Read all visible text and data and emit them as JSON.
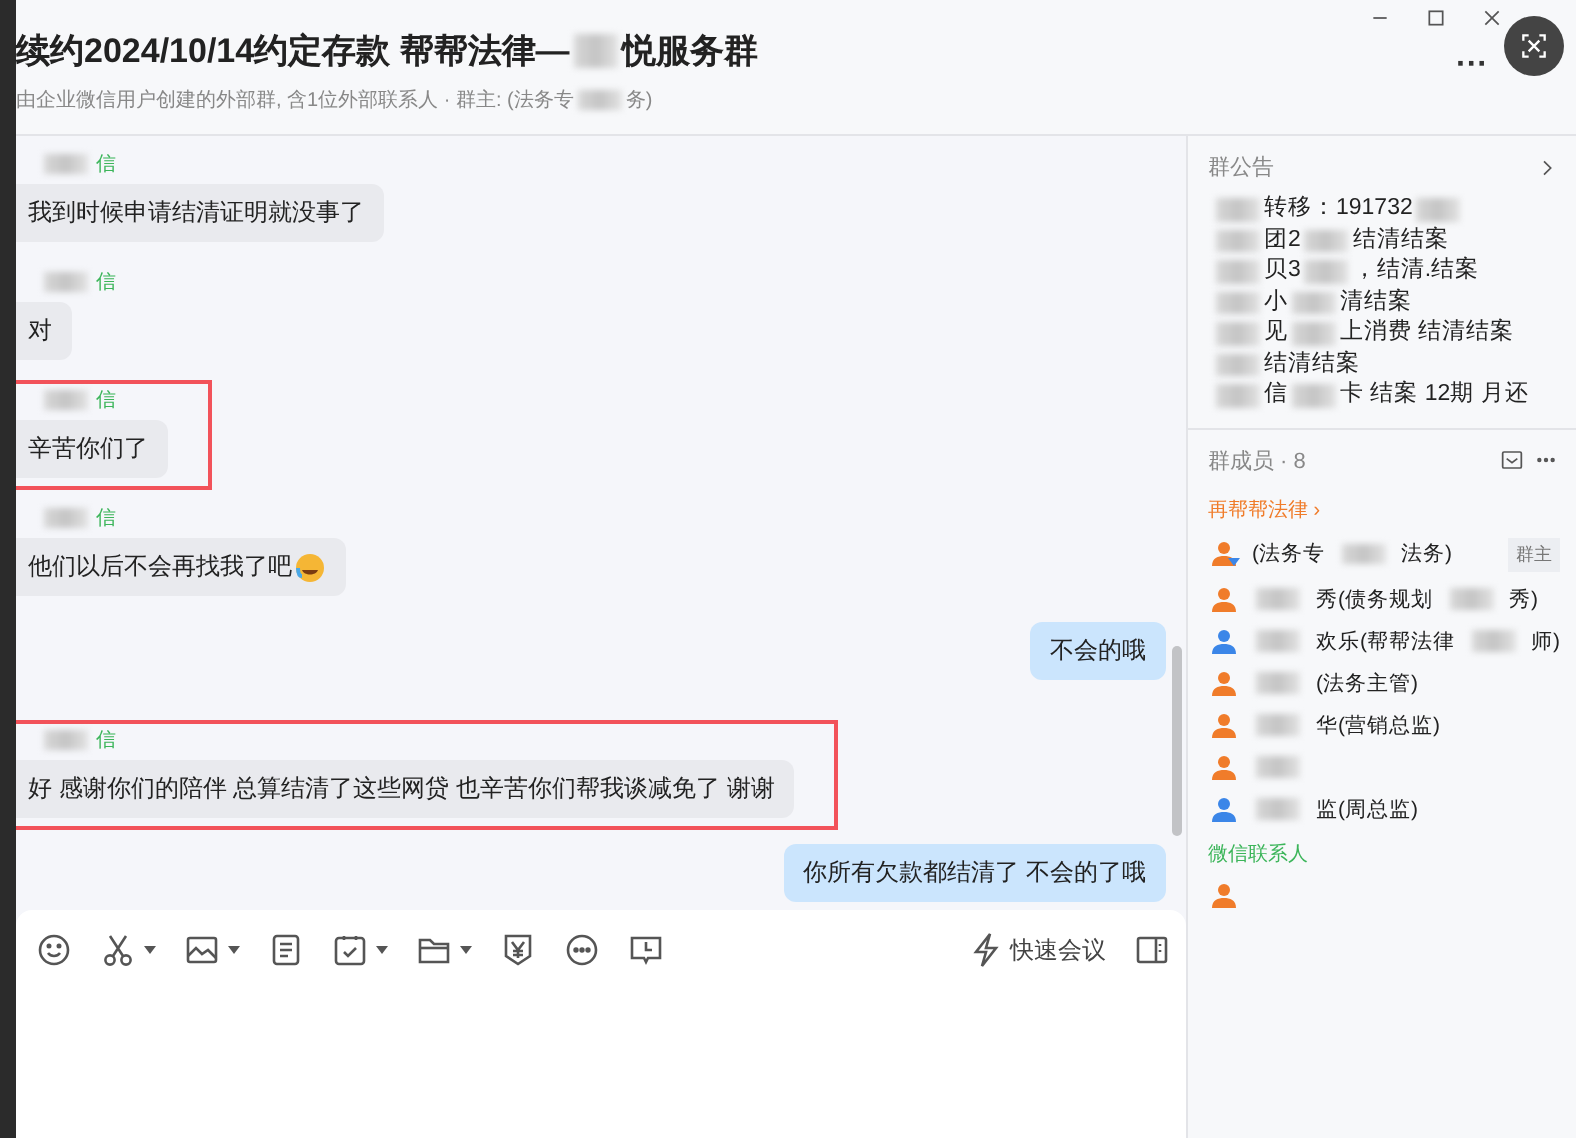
{
  "header": {
    "title": [
      {
        "kind": "text",
        "text": "续约2024/10/14约定存款 帮帮法律—"
      },
      {
        "kind": "blur"
      },
      {
        "kind": "text",
        "text": "悦服务群"
      }
    ],
    "subtitle": [
      {
        "kind": "text",
        "text": "由企业微信用户创建的外部群, 含1位外部联系人 · 群主: (法务专"
      },
      {
        "kind": "blur"
      },
      {
        "kind": "text",
        "text": "务)"
      }
    ],
    "menu": "···"
  },
  "messages": [
    {
      "kind": "received",
      "sender": "信",
      "text": "我到时候申请结清证明就没事了",
      "highlighted": false,
      "emoji": false
    },
    {
      "kind": "received",
      "sender": "信",
      "text": "对",
      "highlighted": false,
      "emoji": false
    },
    {
      "kind": "received",
      "sender": "信",
      "text": "辛苦你们了",
      "highlighted": true,
      "emoji": false
    },
    {
      "kind": "received",
      "sender": "信",
      "text": "他们以后不会再找我了吧",
      "highlighted": false,
      "emoji": true
    },
    {
      "kind": "sent",
      "text": "不会的哦",
      "highlighted": false,
      "emoji": false
    },
    {
      "kind": "received",
      "sender": "信",
      "text": "好  感谢你们的陪伴 总算结清了这些网贷 也辛苦你们帮我谈减免了   谢谢",
      "highlighted": true,
      "emoji": false
    },
    {
      "kind": "sent",
      "text": "你所有欠款都结清了 不会的了哦",
      "highlighted": false,
      "emoji": false
    }
  ],
  "composer": {
    "meeting_button": "快速会议"
  },
  "announcement": {
    "title": "群公告",
    "lines": [
      [
        {
          "kind": "blur"
        },
        {
          "kind": "text",
          "text": "转移：191732"
        },
        {
          "kind": "blur"
        }
      ],
      [
        {
          "kind": "blur"
        },
        {
          "kind": "text",
          "text": "团2"
        },
        {
          "kind": "blur"
        },
        {
          "kind": "text",
          "text": "结清结案"
        }
      ],
      [
        {
          "kind": "blur"
        },
        {
          "kind": "text",
          "text": "贝3"
        },
        {
          "kind": "blur"
        },
        {
          "kind": "text",
          "text": "，结清.结案"
        }
      ],
      [
        {
          "kind": "blur"
        },
        {
          "kind": "text",
          "text": "小"
        },
        {
          "kind": "blur"
        },
        {
          "kind": "text",
          "text": "清结案"
        }
      ],
      [
        {
          "kind": "blur"
        },
        {
          "kind": "text",
          "text": "见"
        },
        {
          "kind": "blur"
        },
        {
          "kind": "text",
          "text": "上消费 结清结案"
        }
      ],
      [
        {
          "kind": "blur"
        },
        {
          "kind": "text",
          "text": "结清结案"
        }
      ],
      [
        {
          "kind": "blur"
        },
        {
          "kind": "text",
          "text": "信"
        },
        {
          "kind": "blur"
        },
        {
          "kind": "text",
          "text": "卡 结案 12期 月还"
        }
      ]
    ]
  },
  "members": {
    "title": "群成员 · 8",
    "groups": [
      {
        "name": "再帮帮法律 ›",
        "color": "#f07c2a",
        "items": [
          {
            "color": "#f07c2a",
            "owner": true,
            "badge": "群主",
            "parts": [
              {
                "kind": "text",
                "text": "(法务专"
              },
              {
                "kind": "blur"
              },
              {
                "kind": "text",
                "text": "法务)"
              }
            ]
          },
          {
            "color": "#f07c2a",
            "owner": false,
            "parts": [
              {
                "kind": "blur"
              },
              {
                "kind": "text",
                "text": "秀(债务规划"
              },
              {
                "kind": "blur"
              },
              {
                "kind": "text",
                "text": "秀)"
              }
            ]
          },
          {
            "color": "#3b86e8",
            "owner": false,
            "parts": [
              {
                "kind": "blur"
              },
              {
                "kind": "text",
                "text": "欢乐(帮帮法律"
              },
              {
                "kind": "blur"
              },
              {
                "kind": "text",
                "text": "师)"
              }
            ]
          },
          {
            "color": "#f07c2a",
            "owner": false,
            "parts": [
              {
                "kind": "blur"
              },
              {
                "kind": "text",
                "text": "(法务主管)"
              }
            ]
          },
          {
            "color": "#f07c2a",
            "owner": false,
            "parts": [
              {
                "kind": "blur"
              },
              {
                "kind": "text",
                "text": "华(营销总监)"
              }
            ]
          },
          {
            "color": "#f07c2a",
            "owner": false,
            "parts": [
              {
                "kind": "blur"
              }
            ]
          },
          {
            "color": "#3b86e8",
            "owner": false,
            "parts": [
              {
                "kind": "blur"
              },
              {
                "kind": "text",
                "text": "监(周总监)"
              }
            ]
          }
        ]
      },
      {
        "name": "微信联系人",
        "color": "#3cb55a",
        "items": [
          {
            "color": "#f07c2a",
            "owner": false
          }
        ]
      }
    ]
  }
}
